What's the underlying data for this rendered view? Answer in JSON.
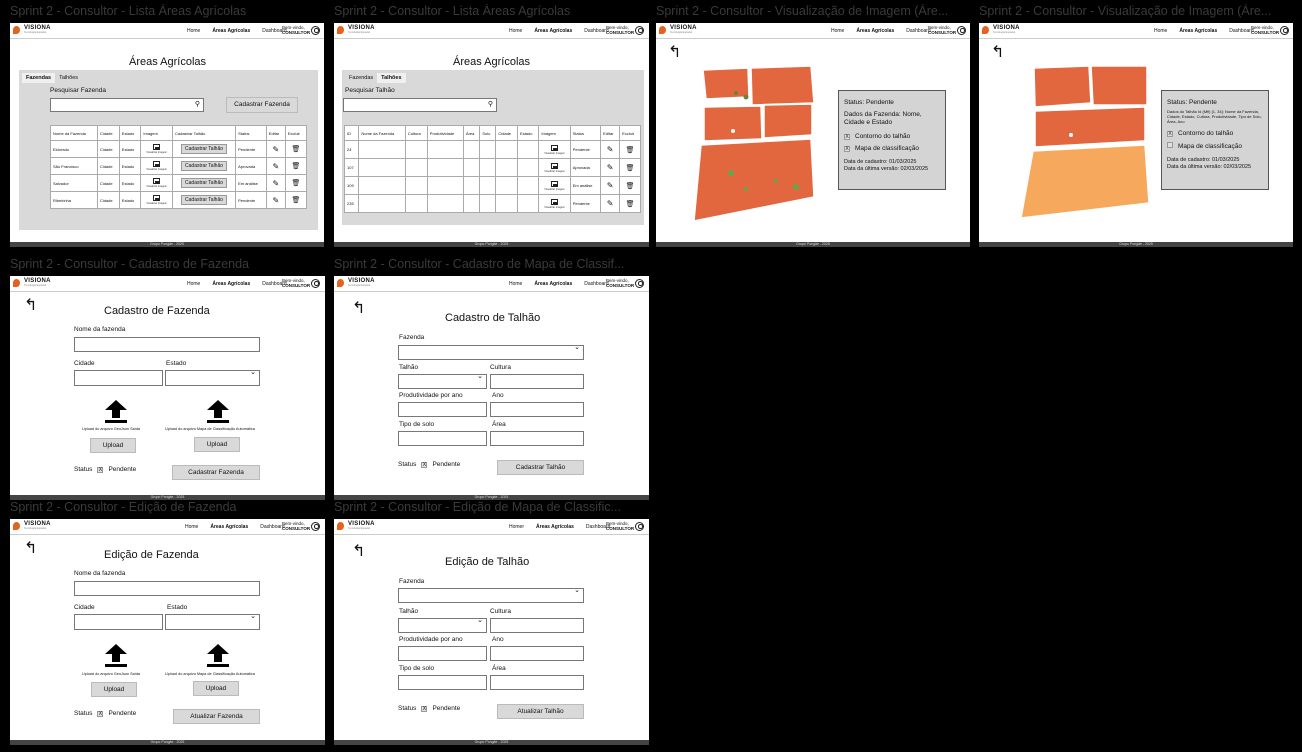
{
  "boards": {
    "b1": {
      "label": "Sprint 2 - Consultor - Lista Áreas Agrícolas"
    },
    "b2": {
      "label": "Sprint 2 - Consultor - Lista Áreas Agrícolas"
    },
    "b3": {
      "label": "Sprint 2 - Consultor - Visualização de Imagem (Áre..."
    },
    "b4": {
      "label": "Sprint 2 - Consultor - Visualização de Imagem (Áre..."
    },
    "b5": {
      "label": "Sprint 2 - Consultor - Cadastro de Fazenda"
    },
    "b6": {
      "label": "Sprint 2 - Consultor - Cadastro de Mapa de Classif..."
    },
    "b7": {
      "label": "Sprint 2 - Consultor - Edição de Fazenda"
    },
    "b8": {
      "label": "Sprint 2 - Consultor - Edição de Mapa de Classific..."
    }
  },
  "header": {
    "logo": "VISIONA",
    "logo_sub": "Tecnologia Espacial",
    "nav_home": "Home",
    "nav_home_alt": "Homer",
    "nav_areas": "Áreas Agrícolas",
    "nav_dashboard": "Dashboard",
    "welcome": "Bem-vindo,",
    "role": "CONSULTOR"
  },
  "footer": "Grupo Pongâe - 2025",
  "lista": {
    "title": "Áreas Agrícolas",
    "tab_fazendas": "Fazendas",
    "tab_talhoes": "Talhões",
    "search_fazenda": "Pesquisar Fazenda",
    "search_talhao": "Pesquisar Talhão",
    "cadastrar_fazenda": "Cadastrar Fazenda",
    "fazenda_cols": [
      "Nome da Fazenda",
      "Cidade",
      "Estado",
      "Imagem",
      "Cadastrar Talhão",
      "Status",
      "Editar",
      "Excluir"
    ],
    "fazenda_rows": [
      {
        "nome": "Eldorado",
        "cidade": "Cidade",
        "estado": "Estado",
        "status": "Pendente"
      },
      {
        "nome": "São Francisco",
        "cidade": "Cidade",
        "estado": "Estado",
        "status": "Aprovada"
      },
      {
        "nome": "Salvador",
        "cidade": "Cidade",
        "estado": "Estado",
        "status": "Em análise"
      },
      {
        "nome": "Ribeirinha",
        "cidade": "Cidade",
        "estado": "Estado",
        "status": "Pendente"
      }
    ],
    "visualizar": "Visualizar Imagem",
    "cadastrar_talhao": "Cadastrar Talhão",
    "talhao_cols": [
      "ID",
      "Nome da Fazenda",
      "Cultura",
      "Produtividade",
      "Área",
      "Solo",
      "Cidade",
      "Estado",
      "Imagem",
      "Status",
      "Editar",
      "Excluir"
    ],
    "talhao_rows": [
      {
        "id": "24",
        "status": "Pendente"
      },
      {
        "id": "107",
        "status": "Aprovada"
      },
      {
        "id": "109",
        "status": "Em análise"
      },
      {
        "id": "235",
        "status": "Pendente"
      }
    ]
  },
  "viz": {
    "status": "Status: Pendente",
    "dados": "Dados da Fazenda: Nome, Cidade e Estado",
    "dados_talhao": "Dados do Talhão Id (Mfi) [1, 34]: Nome da Fazenda, Cidade, Estado, Cultura, Produtividade, Tipo de Solo, Área, Ano",
    "contorno": "Contorno do talhão",
    "mapa": "Mapa de classificação",
    "data_cadastro": "Data de cadastro: 01/03/2025",
    "data_versao": "Data da última versão: 02/03/2025",
    "check": "X"
  },
  "form_fazenda": {
    "title_cad": "Cadastro de Fazenda",
    "title_ed": "Edição de Fazenda",
    "nome": "Nome da fazenda",
    "cidade": "Cidade",
    "estado": "Estado",
    "upload_geojson": "Upload do arquivo GeoJson Saída",
    "upload_mapa": "Upload do arquivo Mapa de Classificação Automática",
    "upload": "Upload",
    "status": "Status",
    "pendente": "Pendente",
    "x": "X",
    "cadastrar": "Cadastrar Fazenda",
    "atualizar": "Atualizar Fazenda"
  },
  "form_talhao": {
    "title_cad": "Cadastro de Talhão",
    "title_ed": "Edição de Talhão",
    "fazenda": "Fazenda",
    "talhao": "Talhão",
    "cultura": "Cultura",
    "produtividade": "Produtividade por ano",
    "ano": "Ano",
    "solo": "Tipo de solo",
    "area": "Área",
    "status": "Status",
    "pendente": "Pendente",
    "x": "X",
    "cadastrar": "Cadastrar Talhão",
    "atualizar": "Atualizar Talhão"
  }
}
